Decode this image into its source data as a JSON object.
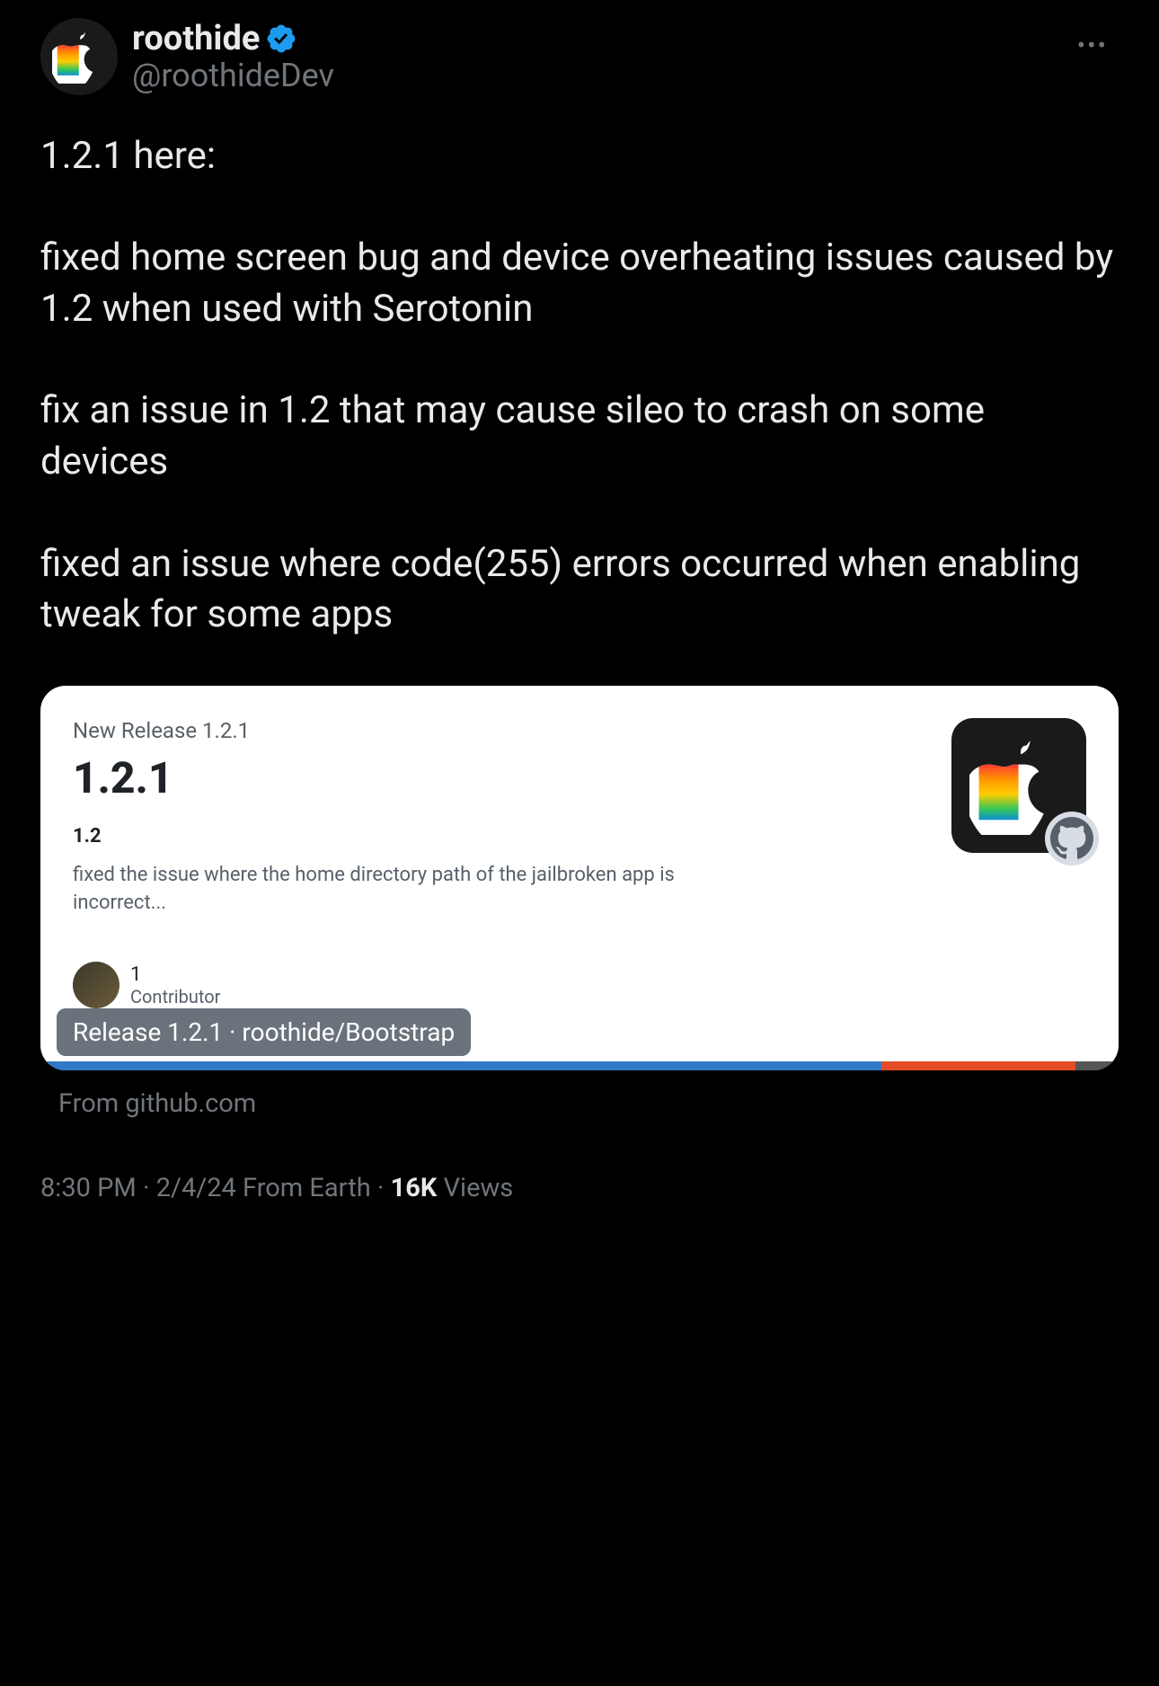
{
  "header": {
    "display_name": "roothide",
    "handle": "@roothideDev"
  },
  "tweet_text": "1.2.1 here:\n\nfixed home screen bug and device overheating issues caused by 1.2 when used with Serotonin\n\nfix an issue in 1.2 that may cause sileo to crash on some devices\n\nfixed an issue where code(255) errors occurred when enabling tweak for some apps",
  "card": {
    "new_release_label": "New Release 1.2.1",
    "version": "1.2.1",
    "prev_version": "1.2",
    "description": "fixed the issue where the home directory path of the jailbroken app is incorrect...",
    "contributor_count": "1",
    "contributor_label": "Contributor",
    "release_pill": "Release 1.2.1 · roothide/Bootstrap",
    "source_label": "From github.com"
  },
  "meta": {
    "time": "8:30 PM",
    "date": "2/4/24",
    "from": "From Earth",
    "views_count": "16K",
    "views_label": "Views"
  }
}
